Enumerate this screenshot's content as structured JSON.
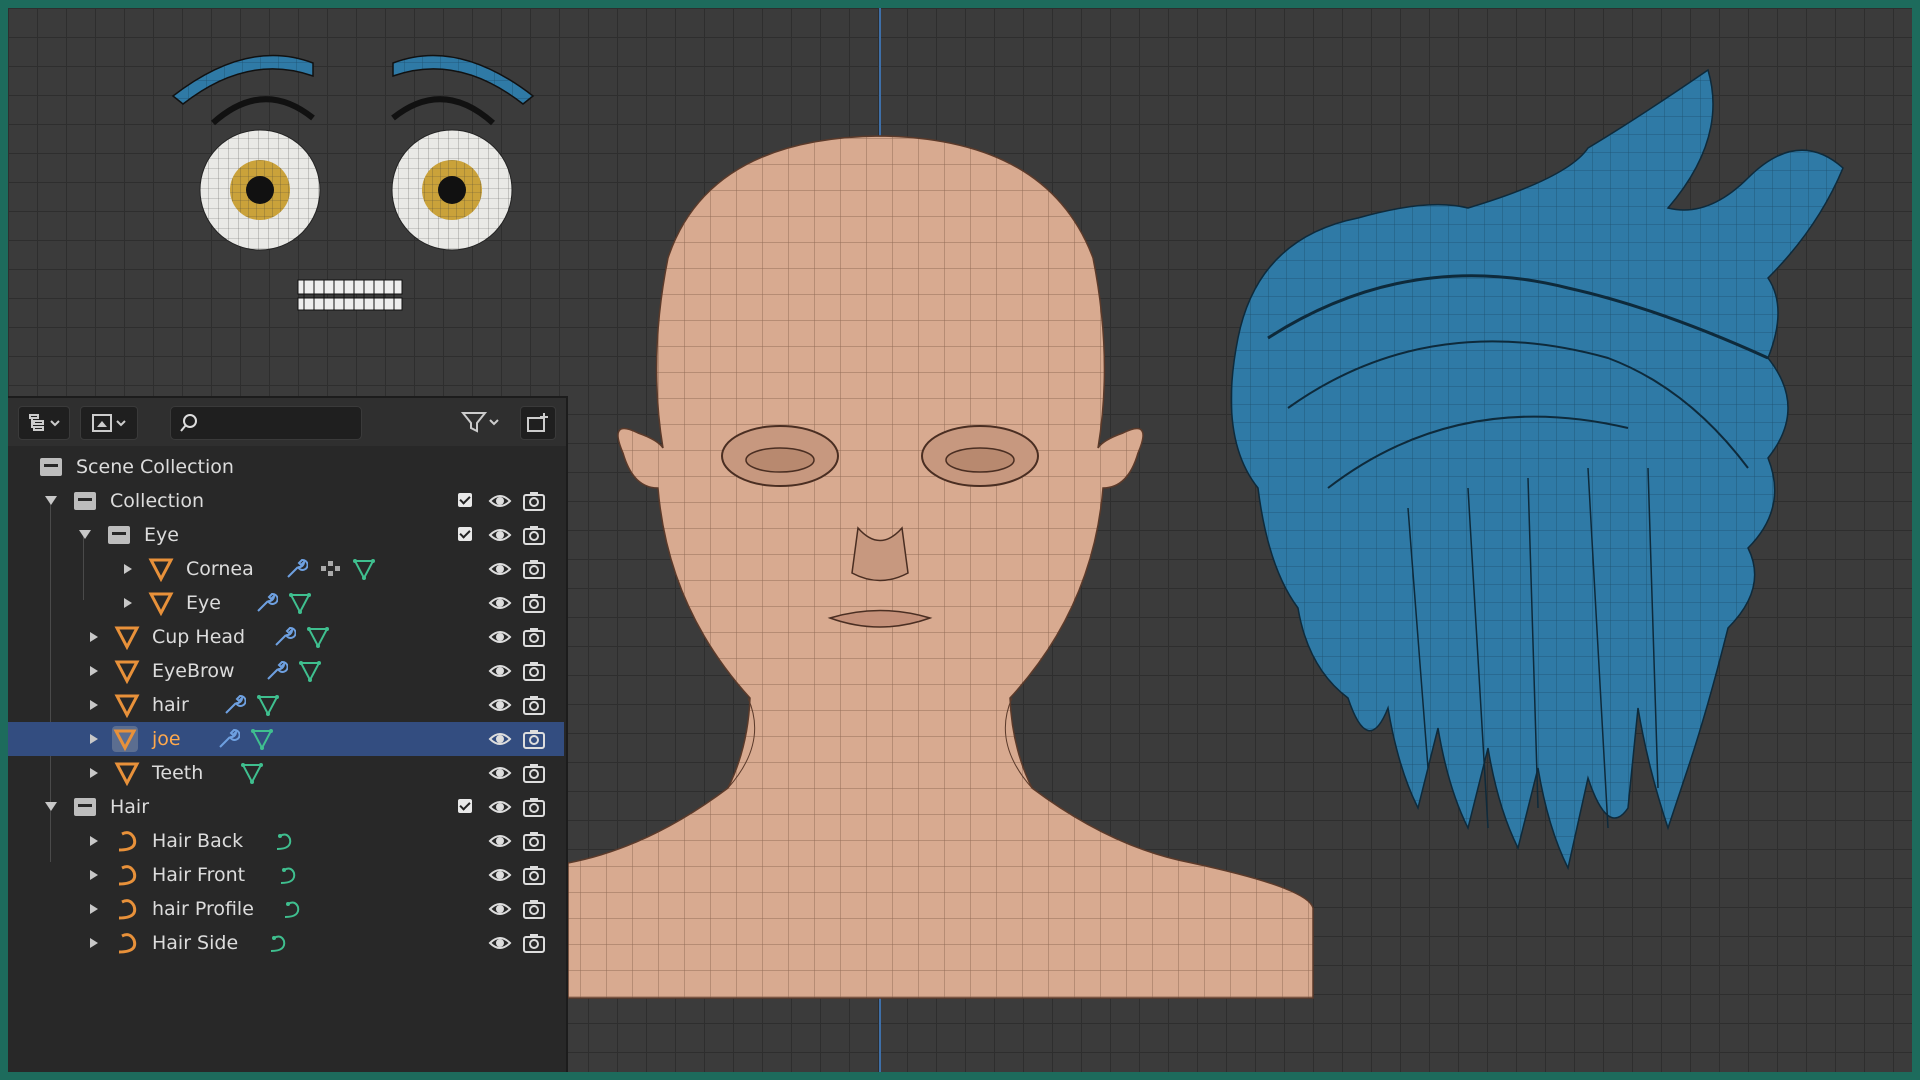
{
  "outliner": {
    "search_placeholder": "",
    "rows": [
      {
        "label": "Scene Collection"
      },
      {
        "label": "Collection"
      },
      {
        "label": "Eye"
      },
      {
        "label": "Cornea"
      },
      {
        "label": "Eye"
      },
      {
        "label": "Cup Head"
      },
      {
        "label": "EyeBrow"
      },
      {
        "label": "hair"
      },
      {
        "label": "joe",
        "selected": true
      },
      {
        "label": "Teeth"
      },
      {
        "label": "Hair"
      },
      {
        "label": "Hair Back"
      },
      {
        "label": "Hair Front"
      },
      {
        "label": "hair Profile"
      },
      {
        "label": "Hair Side"
      }
    ]
  },
  "colors": {
    "border": "#1d6b5c",
    "mesh_skin": "#d6a88e",
    "hair_mesh": "#2f7aa6",
    "selected_row": "#334d80",
    "selected_text": "#ffa94d",
    "mesh_icon": "#e8913a",
    "modifier_icon": "#6ea0e0",
    "data_icon": "#3fbf8f"
  },
  "icons": [
    "outliner-display-icon",
    "filter-icon",
    "search-icon",
    "new-collection-icon",
    "collection-icon",
    "mesh-icon",
    "curve-icon",
    "wrench-icon",
    "particles-icon",
    "mesh-data-icon",
    "curve-data-icon",
    "eye-icon",
    "camera-icon",
    "checkbox-icon"
  ]
}
